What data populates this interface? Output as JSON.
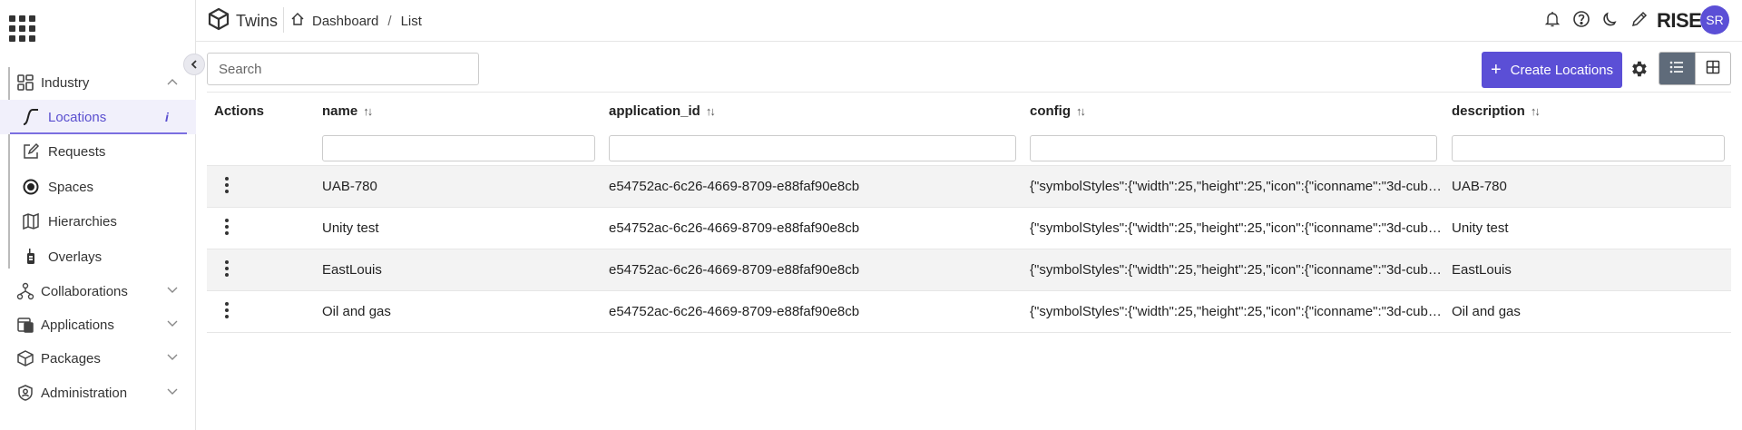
{
  "app": {
    "name": "Twins",
    "brand": "RISE",
    "avatar_initials": "SR"
  },
  "breadcrumb": {
    "home": "Dashboard",
    "separator": "/",
    "current": "List"
  },
  "sidebar": {
    "groups": [
      {
        "label": "Industry",
        "icon": "grid-layout-icon",
        "expanded": true,
        "items": [
          {
            "label": "Locations",
            "icon": "route-icon",
            "active": true,
            "info": "i"
          },
          {
            "label": "Requests",
            "icon": "edit-square-icon"
          },
          {
            "label": "Spaces",
            "icon": "target-icon"
          },
          {
            "label": "Hierarchies",
            "icon": "map-icon"
          },
          {
            "label": "Overlays",
            "icon": "device-icon"
          }
        ]
      },
      {
        "label": "Collaborations",
        "icon": "network-icon"
      },
      {
        "label": "Applications",
        "icon": "applications-icon"
      },
      {
        "label": "Packages",
        "icon": "package-icon"
      },
      {
        "label": "Administration",
        "icon": "shield-user-icon"
      }
    ]
  },
  "toolbar": {
    "search_placeholder": "Search",
    "create_label": "Create Locations",
    "accent": "#5b4fd6"
  },
  "table": {
    "columns": [
      {
        "key": "actions",
        "label": "Actions",
        "sortable": false
      },
      {
        "key": "name",
        "label": "name",
        "sortable": true
      },
      {
        "key": "application_id",
        "label": "application_id",
        "sortable": true
      },
      {
        "key": "config",
        "label": "config",
        "sortable": true
      },
      {
        "key": "description",
        "label": "description",
        "sortable": true
      }
    ],
    "sort_glyph": "↑↓",
    "rows": [
      {
        "name": "UAB-780",
        "application_id": "e54752ac-6c26-4669-8709-e88faf90e8cb",
        "config": "{\"symbolStyles\":{\"width\":25,\"height\":25,\"icon\":{\"iconname\":\"3d-cube.s...",
        "description": "UAB-780"
      },
      {
        "name": "Unity test",
        "application_id": "e54752ac-6c26-4669-8709-e88faf90e8cb",
        "config": "{\"symbolStyles\":{\"width\":25,\"height\":25,\"icon\":{\"iconname\":\"3d-cube.s...",
        "description": "Unity test"
      },
      {
        "name": "EastLouis",
        "application_id": "e54752ac-6c26-4669-8709-e88faf90e8cb",
        "config": "{\"symbolStyles\":{\"width\":25,\"height\":25,\"icon\":{\"iconname\":\"3d-cube.s...",
        "description": "EastLouis"
      },
      {
        "name": "Oil and gas",
        "application_id": "e54752ac-6c26-4669-8709-e88faf90e8cb",
        "config": "{\"symbolStyles\":{\"width\":25,\"height\":25,\"icon\":{\"iconname\":\"3d-cube.s...",
        "description": "Oil and gas"
      }
    ]
  }
}
